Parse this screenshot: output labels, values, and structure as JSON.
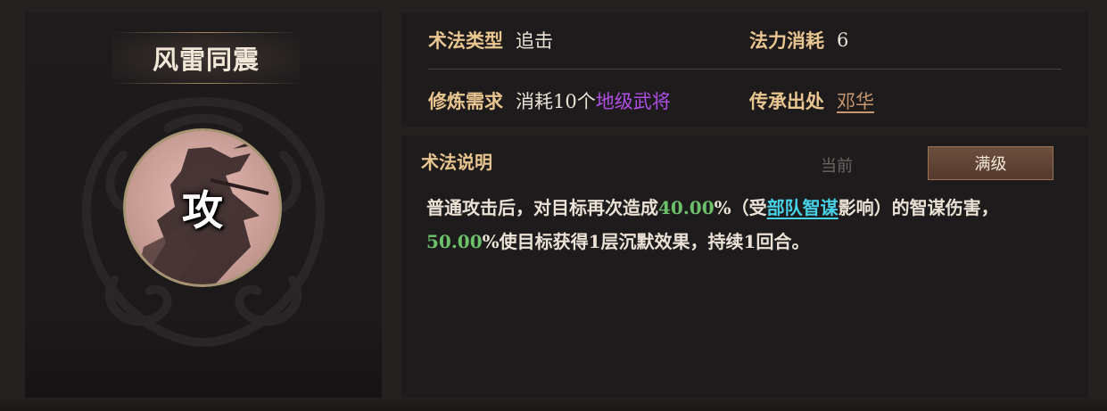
{
  "skill": {
    "name": "风雷同震",
    "emblem_char": "攻"
  },
  "info": {
    "type_label": "术法类型",
    "type_value": "追击",
    "cost_label": "法力消耗",
    "cost_value": "6",
    "req_label": "修炼需求",
    "req_prefix": "消耗10个",
    "req_highlight": "地级武将",
    "origin_label": "传承出处",
    "origin_value": "邓华"
  },
  "description": {
    "title": "术法说明",
    "tab_current": "当前",
    "tab_max": "满级",
    "parts": {
      "p1": "普通攻击后，对目标再次造成",
      "v1": "40.00",
      "p2": "%（受",
      "link": "部队智谋",
      "p3": "影响）的智谋伤害，",
      "v2": "50.00",
      "p4": "%使目标获得1层沉默效果，持续1回合。"
    }
  },
  "colors": {
    "label_gold": "#e9c58f",
    "highlight_purple": "#b04ee7",
    "value_green": "#6cc06a",
    "link_cyan": "#46d2e8",
    "origin_copper": "#c9976f"
  }
}
